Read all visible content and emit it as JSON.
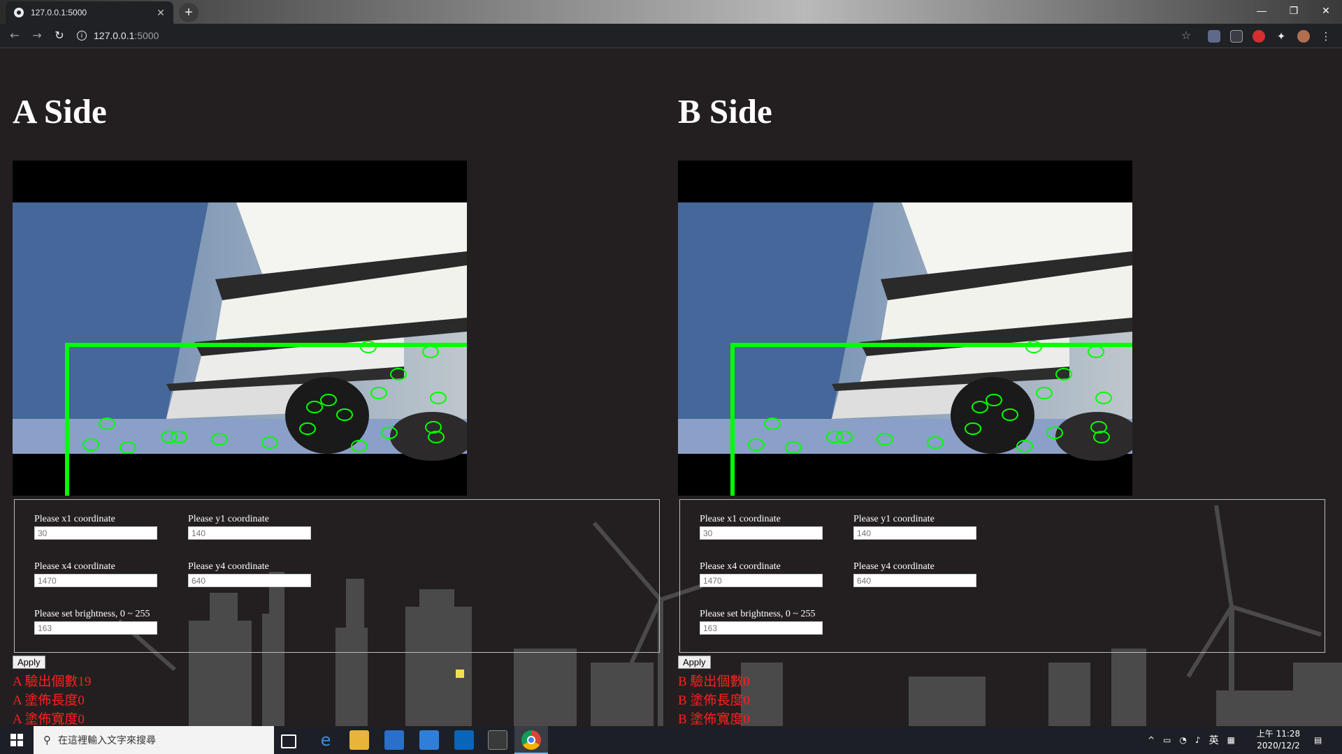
{
  "browser": {
    "tab_title": "127.0.0.1:5000",
    "tab_close": "✕",
    "new_tab": "+",
    "url_host": "127.0.0.1",
    "url_port": ":5000",
    "window_controls": [
      "—",
      "❐",
      "✕"
    ]
  },
  "sides": [
    {
      "title": "A Side",
      "x1_label": "Please x1 coordinate",
      "x1_value": "30",
      "y1_label": "Please y1 coordinate",
      "y1_value": "140",
      "x4_label": "Please x4 coordinate",
      "x4_value": "1470",
      "y4_label": "Please y4 coordinate",
      "y4_value": "640",
      "brightness_label": "Please set brightness, 0 ~ 255",
      "brightness_value": "163",
      "apply_label": "Apply",
      "stat_count": "A 驗出個數19",
      "stat_length": "A 塗佈長度0",
      "stat_width": "A 塗佈寬度0"
    },
    {
      "title": "B Side",
      "x1_label": "Please x1 coordinate",
      "x1_value": "30",
      "y1_label": "Please y1 coordinate",
      "y1_value": "140",
      "x4_label": "Please x4 coordinate",
      "x4_value": "1470",
      "y4_label": "Please y4 coordinate",
      "y4_value": "640",
      "brightness_label": "Please set brightness, 0 ~ 255",
      "brightness_value": "163",
      "apply_label": "Apply",
      "stat_count": "B 驗出個數0",
      "stat_length": "B 塗佈長度0",
      "stat_width": "B 塗佈寬度0"
    }
  ],
  "taskbar": {
    "search_placeholder": "在這裡輸入文字來搜尋",
    "ime_label": "英",
    "time": "上午 11:28",
    "date": "2020/12/2"
  },
  "colors": {
    "page_background": "#231f20",
    "detection_green": "#00ff00",
    "stat_red": "#ff1f1f"
  }
}
